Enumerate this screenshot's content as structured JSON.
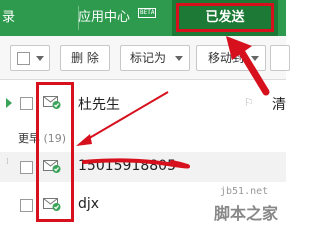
{
  "tabs": {
    "partial_label": "录",
    "app_center_label": "应用中心",
    "app_center_badge": "BETA",
    "sent_label": "已发送"
  },
  "toolbar": {
    "delete_label": "删 除",
    "mark_as_label": "标记为",
    "move_to_label": "移动到"
  },
  "mail_list": {
    "rows": [
      {
        "sender": "杜先生",
        "preview": "清"
      },
      {
        "sender": "15015918805"
      },
      {
        "sender": "djx"
      }
    ],
    "group": {
      "label": "更早",
      "count": "(19)"
    }
  },
  "watermark": {
    "site": "jb51.net",
    "brand": "脚本之家"
  },
  "colors": {
    "brand_green": "#2d9a4e",
    "active_tab": "#1d7a36",
    "annotation_red": "#d7101d",
    "read_icon_green": "#3aa35a"
  },
  "icons": {
    "envelope_read": "envelope-check-icon",
    "unread_indicator": "play-triangle-icon",
    "flag": "flag-icon"
  }
}
